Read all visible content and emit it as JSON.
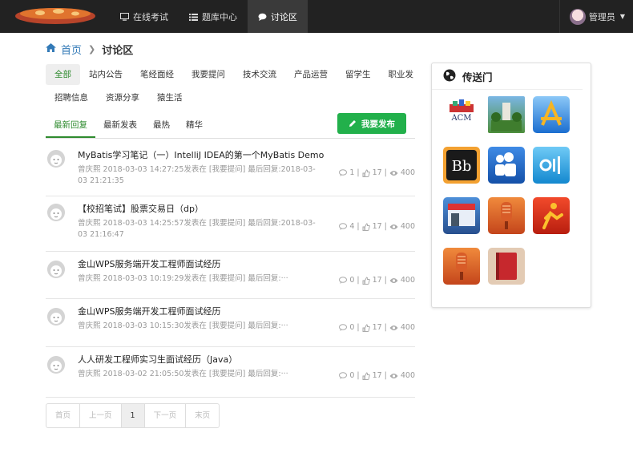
{
  "nav": {
    "items": [
      {
        "label": "在线考试",
        "icon": "monitor-icon"
      },
      {
        "label": "题库中心",
        "icon": "list-icon"
      },
      {
        "label": "讨论区",
        "icon": "chat-icon"
      }
    ],
    "active_index": 2,
    "user": "管理员"
  },
  "breadcrumb": {
    "home": "首页",
    "current": "讨论区"
  },
  "categories": [
    [
      "全部",
      "站内公告",
      "笔经面经",
      "我要提问",
      "技术交流",
      "产品运营",
      "留学生",
      "职业发"
    ],
    [
      "招聘信息",
      "资源分享",
      "猿生活"
    ]
  ],
  "sort_tabs": [
    "最新回复",
    "最新发表",
    "最热",
    "精华"
  ],
  "publish_button": "我要发布",
  "topics": [
    {
      "title": "MyBatis学习笔记（一）IntelliJ IDEA的第一个MyBatis Demo",
      "meta": "曾庆熙   2018-03-03 14:27:25发表在 [我要提问]   最后回复:2018-03-03 21:21:35",
      "replies": "1",
      "likes": "17",
      "views": "400"
    },
    {
      "title": "【校招笔试】股票交易日（dp）",
      "meta": "曾庆熙   2018-03-03 14:25:57发表在 [我要提问]   最后回复:2018-03-03 21:16:47",
      "replies": "4",
      "likes": "17",
      "views": "400"
    },
    {
      "title": "金山WPS服务端开发工程师面试经历",
      "meta": "曾庆熙   2018-03-03 10:19:29发表在 [我要提问]   最后回复:···",
      "replies": "0",
      "likes": "17",
      "views": "400"
    },
    {
      "title": "金山WPS服务端开发工程师面试经历",
      "meta": "曾庆熙   2018-03-03 10:15:30发表在 [我要提问]   最后回复:···",
      "replies": "0",
      "likes": "17",
      "views": "400"
    },
    {
      "title": "人人研发工程师实习生面试经历（Java）",
      "meta": "曾庆熙   2018-03-02 21:05:50发表在 [我要提问]   最后回复:···",
      "replies": "0",
      "likes": "17",
      "views": "400"
    }
  ],
  "pagination": [
    "首页",
    "上一页",
    "1",
    "下一页",
    "末页"
  ],
  "portal": {
    "title": "传送门",
    "acm_label": "ACM",
    "tiles": [
      "acm-logo",
      "campus-photo",
      "appstore-icon",
      "blackboard-icon",
      "myspace-icon",
      "ondemand-icon",
      "store-icon",
      "mic-icon",
      "aim-icon",
      "mic2-icon",
      "notebook-icon"
    ]
  }
}
